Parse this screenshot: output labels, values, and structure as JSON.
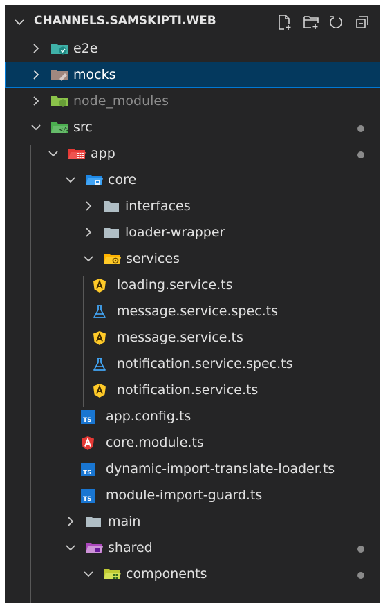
{
  "explorer": {
    "root_title": "CHANNELS.SAMSKIPTI.WEB",
    "actions": [
      {
        "name": "new-file",
        "icon": "new-file-icon"
      },
      {
        "name": "new-folder",
        "icon": "new-folder-icon"
      },
      {
        "name": "refresh",
        "icon": "refresh-icon"
      },
      {
        "name": "collapse-all",
        "icon": "collapse-all-icon"
      }
    ]
  },
  "tree": [
    {
      "label": "e2e",
      "type": "folder",
      "state": "collapsed",
      "icon": "e2e-folder-icon",
      "depth": 0
    },
    {
      "label": "mocks",
      "type": "folder",
      "state": "collapsed",
      "icon": "mocks-folder-icon",
      "depth": 0,
      "selected": true
    },
    {
      "label": "node_modules",
      "type": "folder",
      "state": "collapsed",
      "icon": "node-folder-icon",
      "depth": 0,
      "dimmed": true
    },
    {
      "label": "src",
      "type": "folder",
      "state": "expanded",
      "icon": "src-folder-icon",
      "depth": 0,
      "modified": true
    },
    {
      "label": "app",
      "type": "folder",
      "state": "expanded",
      "icon": "app-folder-icon",
      "depth": 1,
      "modified": true
    },
    {
      "label": "core",
      "type": "folder",
      "state": "expanded",
      "icon": "core-folder-icon",
      "depth": 2
    },
    {
      "label": "interfaces",
      "type": "folder",
      "state": "collapsed",
      "icon": "folder-icon",
      "depth": 3
    },
    {
      "label": "loader-wrapper",
      "type": "folder",
      "state": "collapsed",
      "icon": "folder-icon",
      "depth": 3
    },
    {
      "label": "services",
      "type": "folder",
      "state": "expanded",
      "icon": "services-folder-icon",
      "depth": 3
    },
    {
      "label": "loading.service.ts",
      "type": "file",
      "icon": "angular-service-icon",
      "depth": 4
    },
    {
      "label": "message.service.spec.ts",
      "type": "file",
      "icon": "test-flask-icon",
      "depth": 4
    },
    {
      "label": "message.service.ts",
      "type": "file",
      "icon": "angular-service-icon",
      "depth": 4
    },
    {
      "label": "notification.service.spec.ts",
      "type": "file",
      "icon": "test-flask-icon",
      "depth": 4
    },
    {
      "label": "notification.service.ts",
      "type": "file",
      "icon": "angular-service-icon",
      "depth": 4
    },
    {
      "label": "app.config.ts",
      "type": "file",
      "icon": "typescript-icon",
      "depth": 3
    },
    {
      "label": "core.module.ts",
      "type": "file",
      "icon": "angular-module-icon",
      "depth": 3
    },
    {
      "label": "dynamic-import-translate-loader.ts",
      "type": "file",
      "icon": "typescript-icon",
      "depth": 3
    },
    {
      "label": "module-import-guard.ts",
      "type": "file",
      "icon": "typescript-icon",
      "depth": 3
    },
    {
      "label": "main",
      "type": "folder",
      "state": "collapsed",
      "icon": "folder-icon",
      "depth": 2
    },
    {
      "label": "shared",
      "type": "folder",
      "state": "expanded",
      "icon": "shared-folder-icon",
      "depth": 2,
      "modified": true
    },
    {
      "label": "components",
      "type": "folder",
      "state": "expanded",
      "icon": "components-folder-icon",
      "depth": 3,
      "modified": true
    }
  ]
}
